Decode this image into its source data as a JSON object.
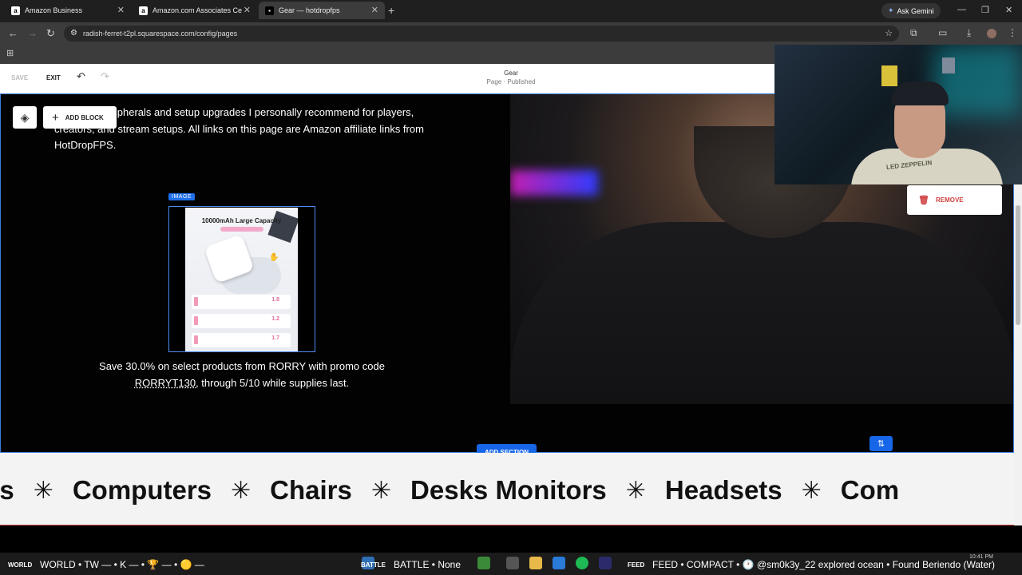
{
  "browser": {
    "tabs": [
      {
        "label": "Amazon Business",
        "icon": "amazon-icon",
        "active": false
      },
      {
        "label": "Amazon.com Associates Central",
        "icon": "amazon-icon",
        "active": false
      },
      {
        "label": "Gear — hotdropfps",
        "icon": "squarespace-icon",
        "active": true
      }
    ],
    "gemini_label": "Ask Gemini",
    "url": "radish-ferret-t2pl.squarespace.com/config/pages"
  },
  "editor": {
    "save_label": "SAVE",
    "exit_label": "EXIT",
    "page_title": "Gear",
    "page_status": "Page · Published"
  },
  "canvas": {
    "add_block_label": "ADD BLOCK",
    "intro_text": "e gaming peripherals and setup upgrades I personally recommend for players, creators, and stream setups. All links on this page are Amazon affiliate links from HotDropFPS.",
    "image_tag": "IMAGE",
    "product": {
      "headline": "10000mAh Large Capacity",
      "rows": [
        "1.8",
        "1.2",
        "1.7"
      ]
    },
    "promo_prefix": "Save 30.0% on select products from RORRY with promo code ",
    "promo_code": "RORRYT130",
    "promo_suffix": ", through 5/10 while supplies last.",
    "remove_label": "REMOVE",
    "add_section_label": "ADD SECTION"
  },
  "ticker": {
    "items": [
      "ets",
      "Computers",
      "Chairs",
      "Desks Monitors",
      "Headsets",
      "Com"
    ],
    "separator": "✳"
  },
  "webcam": {
    "shirt_text": "LED ZEPPELIN"
  },
  "taskbar": {
    "world_small": "WORLD",
    "world_text": "WORLD • TW — • K — • 🏆 — • 🟡 —",
    "battle_small": "BATTLE",
    "battle_text": "BATTLE • None",
    "feed_small": "FEED",
    "feed_text": "FEED • COMPACT • 🕐 @sm0k3y_22 explored ocean • Found Beriendo (Water)",
    "clock": "10:41 PM"
  }
}
